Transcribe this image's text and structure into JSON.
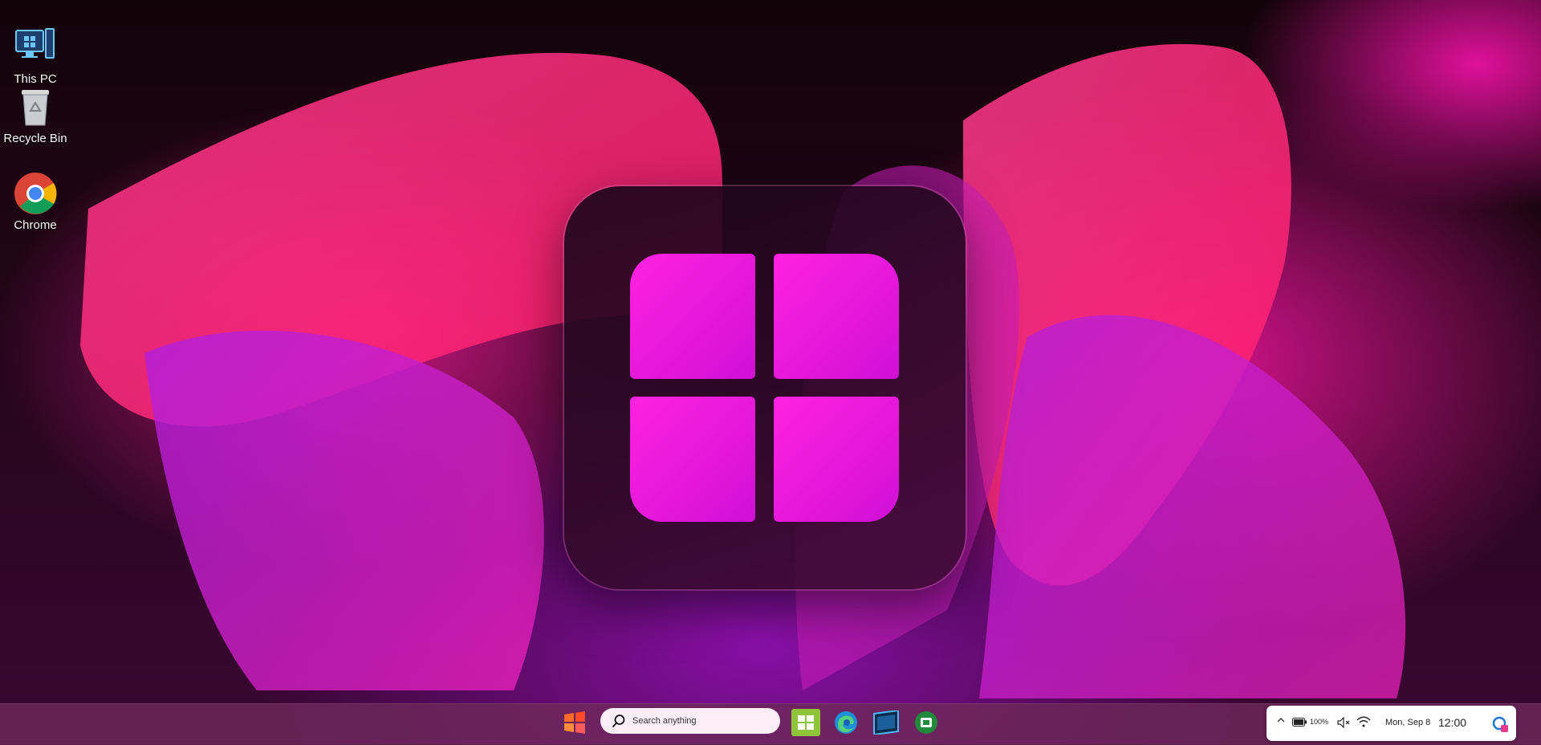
{
  "desktop": {
    "icons": [
      {
        "label": "This PC",
        "icon": "this-pc-icon"
      },
      {
        "label": "Recycle Bin",
        "icon": "recycle-bin-icon"
      },
      {
        "label": "Chrome",
        "icon": "chrome-icon"
      }
    ]
  },
  "center_logo": {
    "icon": "windows-logo-icon",
    "accent": "#ff22e0"
  },
  "taskbar": {
    "start_icon": "windows-start-icon",
    "search": {
      "placeholder": "Search anything",
      "icon": "search-icon"
    },
    "apps": [
      {
        "name": "widgets-app",
        "icon": "widgets-icon"
      },
      {
        "name": "edge-app",
        "icon": "edge-icon"
      },
      {
        "name": "app-3",
        "icon": "app-window-icon"
      },
      {
        "name": "app-4",
        "icon": "green-circle-app-icon"
      }
    ]
  },
  "tray": {
    "chevron_icon": "chevron-up-icon",
    "battery_percent": "100%",
    "date": "Mon, Sep 8",
    "time": "12:00",
    "copilot_icon": "copilot-icon"
  },
  "colors": {
    "taskbar": "#6e285a",
    "tray_bg": "#ffffff",
    "logo_pink": "#ff22e0"
  }
}
